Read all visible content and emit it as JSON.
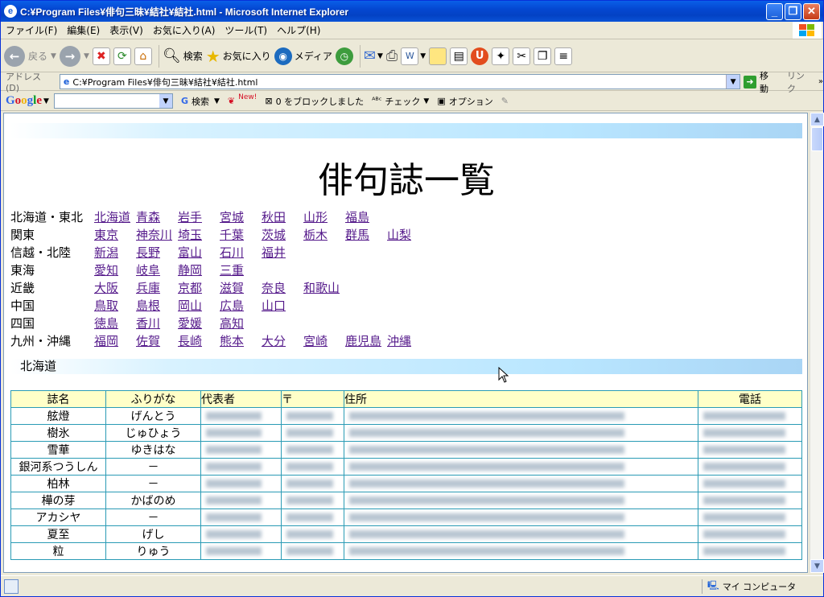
{
  "window": {
    "title": "C:¥Program Files¥俳句三昧¥結社¥結社.html - Microsoft Internet Explorer"
  },
  "menu": [
    "ファイル(F)",
    "編集(E)",
    "表示(V)",
    "お気に入り(A)",
    "ツール(T)",
    "ヘルプ(H)"
  ],
  "toolbar": {
    "back": "戻る",
    "search": "検索",
    "favorites": "お気に入り",
    "media": "メディア"
  },
  "address": {
    "label": "アドレス(D)",
    "url": "C:¥Program Files¥俳句三昧¥結社¥結社.html",
    "go": "移動",
    "links": "リンク"
  },
  "google": {
    "logo": "Google",
    "search": "検索",
    "new": "New!",
    "blocked": "0 をブロックしました",
    "check": "チェック",
    "options": "オプション"
  },
  "page": {
    "title": "俳句誌一覧",
    "regions": [
      {
        "name": "北海道・東北",
        "links": [
          "北海道",
          "青森",
          "岩手",
          "宮城",
          "秋田",
          "山形",
          "福島"
        ]
      },
      {
        "name": "関東",
        "links": [
          "東京",
          "神奈川",
          "埼玉",
          "千葉",
          "茨城",
          "栃木",
          "群馬",
          "山梨"
        ]
      },
      {
        "name": "信越・北陸",
        "links": [
          "新潟",
          "長野",
          "富山",
          "石川",
          "福井"
        ]
      },
      {
        "name": "東海",
        "links": [
          "愛知",
          "岐阜",
          "静岡",
          "三重"
        ]
      },
      {
        "name": "近畿",
        "links": [
          "大阪",
          "兵庫",
          "京都",
          "滋賀",
          "奈良",
          "和歌山"
        ]
      },
      {
        "name": "中国",
        "links": [
          "鳥取",
          "島根",
          "岡山",
          "広島",
          "山口"
        ]
      },
      {
        "name": "四国",
        "links": [
          "徳島",
          "香川",
          "愛媛",
          "高知"
        ]
      },
      {
        "name": "九州・沖縄",
        "links": [
          "福岡",
          "佐賀",
          "長崎",
          "熊本",
          "大分",
          "宮崎",
          "鹿児島",
          "沖縄"
        ]
      }
    ],
    "section": "北海道",
    "table": {
      "headers": [
        "誌名",
        "ふりがな",
        "代表者",
        "〒",
        "住所",
        "電話"
      ],
      "rows": [
        {
          "name": "舷燈",
          "kana": "げんとう"
        },
        {
          "name": "樹氷",
          "kana": "じゅひょう"
        },
        {
          "name": "雪華",
          "kana": "ゆきはな"
        },
        {
          "name": "銀河系つうしん",
          "kana": "－"
        },
        {
          "name": "柏林",
          "kana": "－"
        },
        {
          "name": "樺の芽",
          "kana": "かばのめ"
        },
        {
          "name": "アカシヤ",
          "kana": "－"
        },
        {
          "name": "夏至",
          "kana": "げし"
        },
        {
          "name": "粒",
          "kana": "りゅう"
        }
      ]
    }
  },
  "status": {
    "zone": "マイ コンピュータ"
  }
}
